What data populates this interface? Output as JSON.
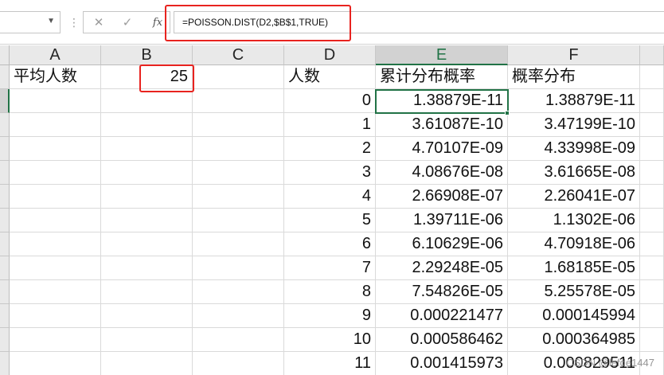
{
  "formula_bar": {
    "name_box_value": "",
    "fx_label": "fx",
    "formula": "=POISSON.DIST(D2,$B$1,TRUE)"
  },
  "columns": [
    "A",
    "B",
    "C",
    "D",
    "E",
    "F"
  ],
  "selected_column": "E",
  "row1": {
    "A": "平均人数",
    "B": "25",
    "D": "人数",
    "E": "累计分布概率",
    "F": "概率分布"
  },
  "data_rows": [
    {
      "d": "0",
      "e": "1.38879E-11",
      "f": "1.38879E-11"
    },
    {
      "d": "1",
      "e": "3.61087E-10",
      "f": "3.47199E-10"
    },
    {
      "d": "2",
      "e": "4.70107E-09",
      "f": "4.33998E-09"
    },
    {
      "d": "3",
      "e": "4.08676E-08",
      "f": "3.61665E-08"
    },
    {
      "d": "4",
      "e": "2.66908E-07",
      "f": "2.26041E-07"
    },
    {
      "d": "5",
      "e": "1.39711E-06",
      "f": "1.1302E-06"
    },
    {
      "d": "6",
      "e": "6.10629E-06",
      "f": "4.70918E-06"
    },
    {
      "d": "7",
      "e": "2.29248E-05",
      "f": "1.68185E-05"
    },
    {
      "d": "8",
      "e": "7.54826E-05",
      "f": "5.25578E-05"
    },
    {
      "d": "9",
      "e": "0.000221477",
      "f": "0.000145994"
    },
    {
      "d": "10",
      "e": "0.000586462",
      "f": "0.000364985"
    },
    {
      "d": "11",
      "e": "0.001415973",
      "f": "0.000829511"
    }
  ],
  "watermark": "CSDN @lefde1447",
  "colors": {
    "accent_green": "#217346",
    "highlight_red": "#e8231f",
    "header_gray": "#e9e9e9"
  },
  "icons": {
    "cancel": "✕",
    "enter": "✓",
    "dropdown": "▼",
    "dots": "⋮"
  }
}
